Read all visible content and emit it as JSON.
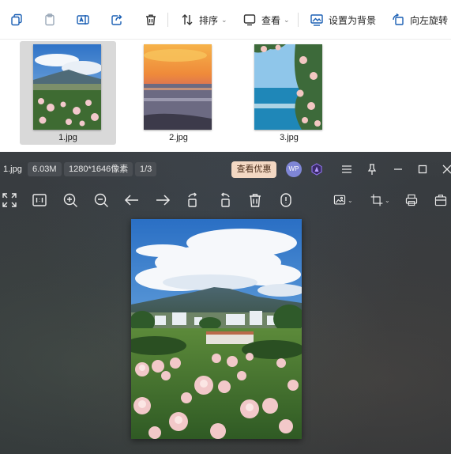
{
  "explorer": {
    "toolbar": {
      "sort_label": "排序",
      "view_label": "查看",
      "set_background_label": "设置为背景",
      "rotate_left_label": "向左旋转"
    },
    "files": [
      {
        "name": "1.jpg",
        "selected": true
      },
      {
        "name": "2.jpg",
        "selected": false
      },
      {
        "name": "3.jpg",
        "selected": false
      }
    ]
  },
  "viewer": {
    "filename": "1.jpg",
    "filesize": "6.03M",
    "dimensions": "1280*1646像素",
    "page_indicator": "1/3",
    "promo_label": "查看优惠",
    "avatar_text": "WP"
  },
  "colors": {
    "promo_bg": "#f3d8c3",
    "selected_tile": "#d9d9d9",
    "avatar": "#7f86d6"
  }
}
